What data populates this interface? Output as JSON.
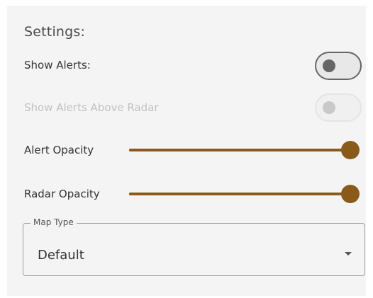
{
  "settings": {
    "title": "Settings:",
    "show_alerts": {
      "label": "Show Alerts:",
      "enabled": true,
      "checked": false
    },
    "show_alerts_above_radar": {
      "label": "Show Alerts Above Radar",
      "enabled": false,
      "checked": false
    },
    "alert_opacity": {
      "label": "Alert Opacity",
      "value": 1.0
    },
    "radar_opacity": {
      "label": "Radar Opacity",
      "value": 1.0
    },
    "map_type": {
      "label": "Map Type",
      "value": "Default"
    },
    "colors": {
      "accent": "#8a5a1a",
      "toggle_off": "#666666",
      "disabled": "#c2c2c2",
      "panel_bg": "#f4f4f4"
    }
  }
}
